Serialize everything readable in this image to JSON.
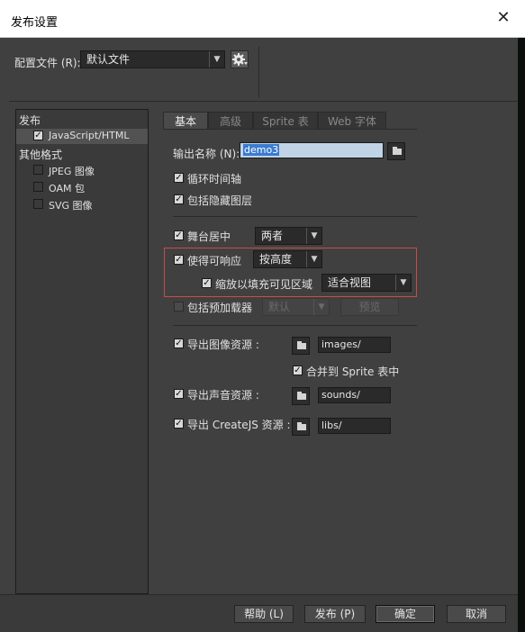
{
  "window": {
    "title": "发布设置",
    "close_glyph": "✕"
  },
  "profile": {
    "label": "配置文件 (R):",
    "value": "默认文件",
    "gear_icon": "gear-icon"
  },
  "sidebar": {
    "group1": "发布",
    "js_item": "JavaScript/HTML",
    "group2": "其他格式",
    "jpeg_item": "JPEG 图像",
    "oam_item": "OAM 包",
    "svg_item": "SVG 图像"
  },
  "tabs": [
    "基本",
    "高级",
    "Sprite 表",
    "Web 字体"
  ],
  "basic": {
    "output_label": "输出名称 (N):",
    "output_value": "demo3",
    "loop_label": "循环时间轴",
    "hidden_label": "包括隐藏图层",
    "center_label": "舞台居中",
    "center_value": "两者",
    "responsive_label": "使得可响应",
    "responsive_value": "按高度",
    "scale_label": "缩放以填充可见区域",
    "scale_value": "适合视图",
    "preloader_label": "包括预加载器",
    "preloader_value": "默认",
    "preview_label": "预览",
    "export_images_label": "导出图像资源 :",
    "images_path": "images/",
    "sprite_label": "合并到 Sprite 表中",
    "export_sounds_label": "导出声音资源 :",
    "sounds_path": "sounds/",
    "export_createjs_label": "导出 CreateJS 资源 :",
    "libs_path": "libs/"
  },
  "footer": {
    "help": "帮助 (L)",
    "publish": "发布 (P)",
    "ok": "确定",
    "cancel": "取消"
  },
  "colors": {
    "dialog_bg": "#404040",
    "highlight_border": "#d04848",
    "selection": "#3b7bd0"
  }
}
